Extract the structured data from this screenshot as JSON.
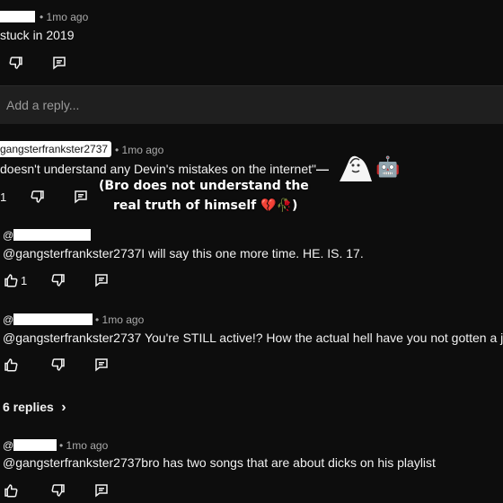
{
  "comments": [
    {
      "id": "c1",
      "time": "1mo ago",
      "text": "stuck in 2019"
    },
    {
      "id": "c2",
      "handle": "gangsterfrankster2737",
      "time": "1mo ago",
      "text": "doesn't understand any Devin's mistakes on the internet\"",
      "likes": "1"
    },
    {
      "id": "c3",
      "handle_prefix": "@",
      "text": "@gangsterfrankster2737I will say this one more time. HE. IS. 17.",
      "likes": "1"
    },
    {
      "id": "c4",
      "handle_prefix": "@",
      "time": "1mo ago",
      "text": "@gangsterfrankster2737 You're STILL active!? How the actual hell have you not gotten a j"
    },
    {
      "id": "c5",
      "handle_prefix": "@",
      "time": "1mo ago",
      "text": "@gangsterfrankster2737bro has two songs that are about dicks on his playlist"
    }
  ],
  "reply_placeholder": "Add a reply...",
  "replies_link": "6 replies",
  "overlay": {
    "line1": "(Bro does not understand the",
    "line2": "real truth of himself 💔🥀)",
    "dash_emoji": "—",
    "robot_emoji": "🤖"
  },
  "dot": "•",
  "chevron": "›",
  "icons": {
    "dislike": "thumbs-down-icon",
    "like": "thumbs-up-icon",
    "reply": "reply-comment-icon"
  }
}
